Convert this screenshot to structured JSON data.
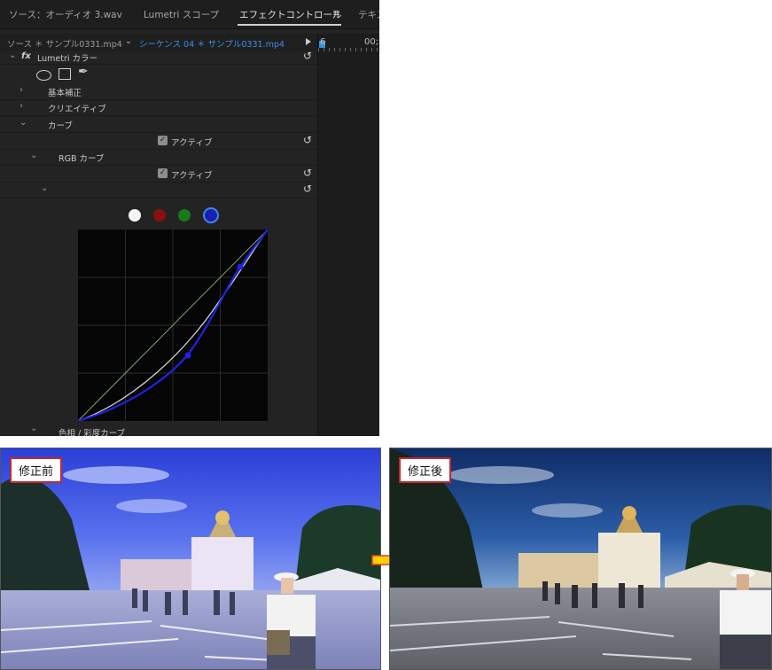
{
  "panel": {
    "tabs": [
      "ソース：オーディオ 3.wav",
      "Lumetri スコープ",
      "エフェクトコントロール",
      "テキス"
    ],
    "menu_icon": "hamburger-menu-icon",
    "source_clip": "ソース ＊ サンプル0331.mp4",
    "sequence_clip": "シーケンス 04 ＊ サンプル0331.mp4",
    "timeline": {
      "left": "6",
      "right": "00;"
    },
    "effect_name": "Lumetri カラー",
    "sections": {
      "basic": "基本補正",
      "creative": "クリエイティブ",
      "curves": "カーブ",
      "rgb_curves": "RGB カーブ",
      "hue_sat": "色相 / 彩度カーブ"
    },
    "active_label": "アクティブ",
    "active_label_2": "アクティブ",
    "channels": [
      "white",
      "red",
      "green",
      "blue"
    ],
    "selected_channel": "blue",
    "curve_colors": {
      "blue": "#1e22e6",
      "white": "#d8d8d8",
      "diagonal": "#7fa36a",
      "grid": "#2c2c2c"
    }
  },
  "photos": {
    "before_label": "修正前",
    "after_label": "修正後",
    "arrow_color": "#ffd000"
  }
}
